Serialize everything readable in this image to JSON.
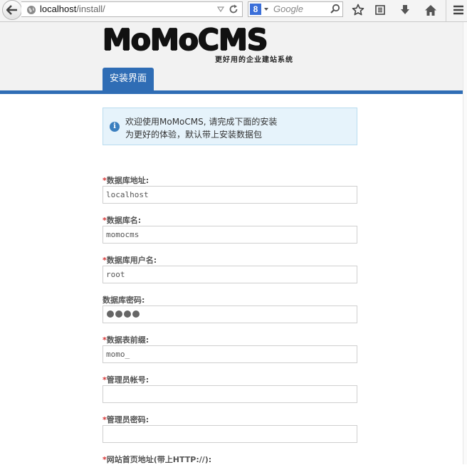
{
  "browser": {
    "url_host": "localhost",
    "url_path": "/install/",
    "search_placeholder": "Google",
    "search_engine_letter": "8"
  },
  "header": {
    "logo": "MoMoCMS",
    "slogan": "更好用的企业建站系统",
    "nav_tab": "安装界面"
  },
  "info": {
    "line1": "欢迎使用MoMoCMS, 请完成下面的安装",
    "line2": "为更好的体验，默认带上安装数据包"
  },
  "fields": [
    {
      "label": "数据库地址:",
      "required": "*",
      "value": "localhost"
    },
    {
      "label": "数据库名:",
      "required": "*",
      "value": "momocms"
    },
    {
      "label": "数据库用户名:",
      "required": "*",
      "value": "root"
    },
    {
      "label": "数据库密码:",
      "required": "",
      "value": "",
      "masked_length": 4
    },
    {
      "label": "数据表前缀:",
      "required": "*",
      "value": "momo_"
    },
    {
      "label": "管理员帐号:",
      "required": "*",
      "value": ""
    },
    {
      "label": "管理员密码:",
      "required": "*",
      "value": ""
    },
    {
      "label": "网站首页地址(带上HTTP://):",
      "required": "*",
      "value": ""
    }
  ],
  "colors": {
    "accent": "#2f6db5",
    "required": "#d63030",
    "info_bg": "#e6f3fb"
  }
}
